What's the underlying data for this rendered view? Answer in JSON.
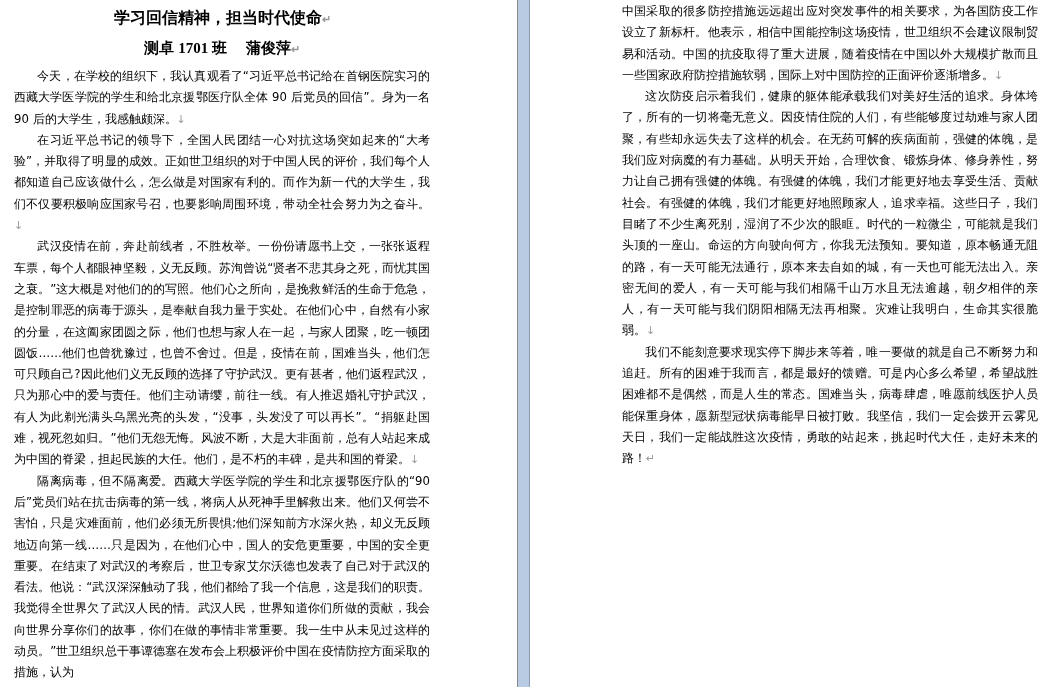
{
  "pages": [
    {
      "title": {
        "text": "学习回信精神，担当时代使命",
        "mark": "↵"
      },
      "byline": {
        "text": "测卓 1701 班　 蒲俊萍",
        "mark": "↵"
      },
      "paragraphs": [
        {
          "kind": "paragraph",
          "text": "今天，在学校的组织下，我认真观看了“习近平总书记给在首钢医院实习的西藏大学医学院的学生和给北京援鄂医疗队全体 90 后党员的回信”。身为一名 90 后的大学生，我感触颇深。",
          "mark": "↓"
        },
        {
          "kind": "paragraph",
          "text": "在习近平总书记的领导下，全国人民团结一心对抗这场突如起来的“大考验”，并取得了明显的成效。正如世卫组织的对于中国人民的评价，我们每个人都知道自己应该做什么，怎么做是对国家有利的。而作为新一代的大学生，我们不仅要积极响应国家号召，也要影响周围环境，带动全社会努力为之奋斗。",
          "mark": "↓"
        },
        {
          "kind": "paragraph",
          "text": "武汉疫情在前，奔赴前线者，不胜枚举。一份份请愿书上交，一张张返程车票，每个人都眼神坚毅，义无反顾。苏洵曾说“贤者不悲其身之死，而忧其国之衰。”这大概是对他们的的写照。他们心之所向，是挽救鲜活的生命于危急，是控制罪恶的病毒于源头，是奉献自我力量于实处。在他们心中，自然有小家的分量，在这阖家团圆之际，他们也想与家人在一起，与家人团聚，吃一顿团圆饭……他们也曾犹豫过，也曾不舍过。但是，疫情在前，国难当头，他们怎可只顾自己?因此他们义无反顾的选择了守护武汉。更有甚者，他们返程武汉，只为那心中的爱与责任。他们主动请缨，前往一线。有人推迟婚礼守护武汉，有人为此剃光满头乌黑光亮的头发，“没事，头发没了可以再长”。“捐躯赴国难，视死忽如归。”他们无怨无悔。风波不断，大是大非面前，总有人站起来成为中国的脊梁，担起民族的大任。他们，是不朽的丰碑，是共和国的脊梁。",
          "mark": "↓"
        },
        {
          "kind": "paragraph",
          "text": "隔离病毒，但不隔离爱。西藏大学医学院的学生和北京援鄂医疗队的“90后”党员们站在抗击病毒的第一线，将病人从死神手里解救出来。他们又何尝不害怕，只是灾难面前，他们必须无所畏惧;他们深知前方水深火热，却义无反顾地迈向第一线……只是因为，在他们心中，国人的安危更重要，中国的安全更重要。在结束了对武汉的考察后，世卫专家艾尔沃德也发表了自己对于武汉的看法。他说：“武汉深深触动了我，他们都给了我一个信息，这是我们的职责。我觉得全世界欠了武汉人民的情。武汉人民，世界知道你们所做的贡献，我会向世界分享你们的故事，你们在做的事情非常重要。我一生中从未见过这样的动员。”世卫组织总干事谭德塞在发布会上积极评价中国在疫情防控方面采取的措施，认为"
        }
      ]
    },
    {
      "paragraphs": [
        {
          "kind": "continuation",
          "text": "中国采取的很多防控措施远远超出应对突发事件的相关要求，为各国防疫工作设立了新标杆。他表示，相信中国能控制这场疫情，世卫组织不会建议限制贸易和活动。中国的抗疫取得了重大进展，随着疫情在中国以外大规模扩散而且一些国家政府防控措施软弱，国际上对中国防控的正面评价逐渐增多。",
          "mark": "↓"
        },
        {
          "kind": "paragraph",
          "text": "这次防疫启示着我们，健康的躯体能承载我们对美好生活的追求。身体垮了，所有的一切将毫无意义。因疫情住院的人们，有些能够度过劫难与家人团聚，有些却永远失去了这样的机会。在无药可解的疾病面前，强健的体魄，是我们应对病魔的有力基础。从明天开始，合理饮食、锻炼身体、修身养性，努力让自己拥有强健的体魄。有强健的体魄，我们才能更好地去享受生活、贡献社会。有强健的体魄，我们才能更好地照顾家人，追求幸福。这些日子，我们目睹了不少生离死别，湿润了不少次的眼眶。时代的一粒微尘，可能就是我们头顶的一座山。命运的方向驶向何方，你我无法预知。要知道，原本畅通无阻的路，有一天可能无法通行，原本来去自如的城，有一天也可能无法出入。亲密无间的爱人，有一天可能与我们相隔千山万水且无法逾越，朝夕相伴的亲人，有一天可能与我们阴阳相隔无法再相聚。灾难让我明白，生命其实很脆弱。",
          "mark": "↓"
        },
        {
          "kind": "paragraph",
          "text": "我们不能刻意要求现实停下脚步来等着，唯一要做的就是自己不断努力和追赶。所有的困难于我而言，都是最好的馈赠。可是内心多么希望，希望战胜困难都不是偶然，而是人生的常态。国难当头，病毒肆虐，唯愿前线医护人员能保重身体，愿新型冠状病毒能早日被打败。我坚信，我们一定会拨开云雾见天日，我们一定能战胜这次疫情，勇敢的站起来，挑起时代大任，走好未来的路！",
          "mark": "↵"
        }
      ]
    }
  ]
}
